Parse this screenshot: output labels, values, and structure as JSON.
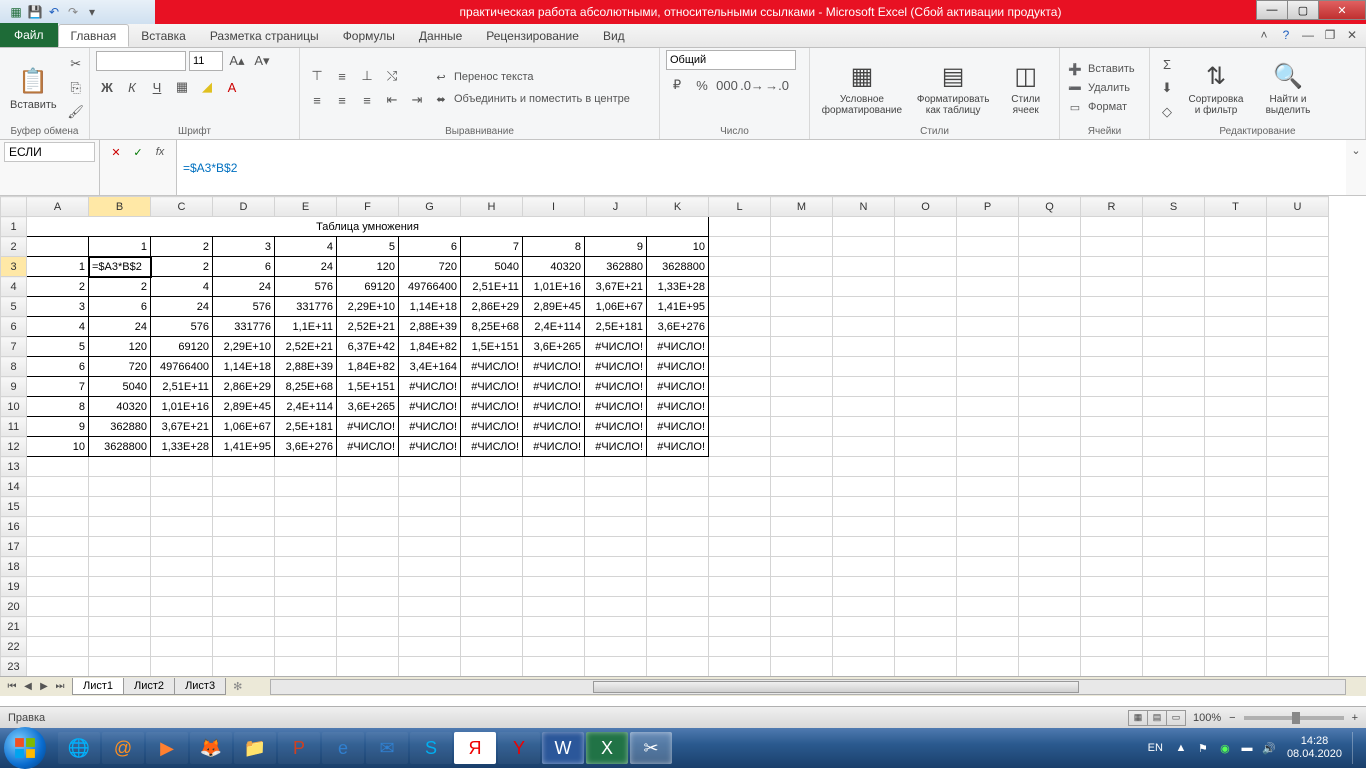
{
  "titlebar": {
    "title": "практическая работа абсолютными, относительными ссылками  -  Microsoft Excel (Сбой активации продукта)"
  },
  "ribbon": {
    "file": "Файл",
    "tabs": [
      "Главная",
      "Вставка",
      "Разметка страницы",
      "Формулы",
      "Данные",
      "Рецензирование",
      "Вид"
    ],
    "activeTab": 0,
    "groups": {
      "clipboard": {
        "label": "Буфер обмена",
        "paste": "Вставить"
      },
      "font": {
        "label": "Шрифт",
        "fontName": "",
        "fontSize": "11"
      },
      "align": {
        "label": "Выравнивание",
        "wrap": "Перенос текста",
        "merge": "Объединить и поместить в центре"
      },
      "number": {
        "label": "Число",
        "format": "Общий"
      },
      "styles": {
        "label": "Стили",
        "cond": "Условное форматирование",
        "table": "Форматировать как таблицу",
        "cell": "Стили ячеек"
      },
      "cells": {
        "label": "Ячейки",
        "insert": "Вставить",
        "delete": "Удалить",
        "format": "Формат"
      },
      "editing": {
        "label": "Редактирование",
        "sort": "Сортировка и фильтр",
        "find": "Найти и выделить"
      }
    }
  },
  "formula_bar": {
    "name_box": "ЕСЛИ",
    "formula": "=$A3*B$2"
  },
  "grid": {
    "columns": [
      "A",
      "B",
      "C",
      "D",
      "E",
      "F",
      "G",
      "H",
      "I",
      "J",
      "K",
      "L",
      "M",
      "N",
      "O",
      "P",
      "Q",
      "R",
      "S",
      "T",
      "U"
    ],
    "active_cell": "B3",
    "title_text": "Таблица умножения",
    "title_span": [
      0,
      10
    ],
    "data_rows": 12,
    "blank_rows_to": 23,
    "rows": [
      null,
      [
        "",
        "1",
        "2",
        "3",
        "4",
        "5",
        "6",
        "7",
        "8",
        "9",
        "10"
      ],
      [
        "1",
        "=$A3*B$2",
        "2",
        "6",
        "24",
        "120",
        "720",
        "5040",
        "40320",
        "362880",
        "3628800"
      ],
      [
        "2",
        "2",
        "4",
        "24",
        "576",
        "69120",
        "49766400",
        "2,51E+11",
        "1,01E+16",
        "3,67E+21",
        "1,33E+28"
      ],
      [
        "3",
        "6",
        "24",
        "576",
        "331776",
        "2,29E+10",
        "1,14E+18",
        "2,86E+29",
        "2,89E+45",
        "1,06E+67",
        "1,41E+95"
      ],
      [
        "4",
        "24",
        "576",
        "331776",
        "1,1E+11",
        "2,52E+21",
        "2,88E+39",
        "8,25E+68",
        "2,4E+114",
        "2,5E+181",
        "3,6E+276"
      ],
      [
        "5",
        "120",
        "69120",
        "2,29E+10",
        "2,52E+21",
        "6,37E+42",
        "1,84E+82",
        "1,5E+151",
        "3,6E+265",
        "#ЧИСЛО!",
        "#ЧИСЛО!"
      ],
      [
        "6",
        "720",
        "49766400",
        "1,14E+18",
        "2,88E+39",
        "1,84E+82",
        "3,4E+164",
        "#ЧИСЛО!",
        "#ЧИСЛО!",
        "#ЧИСЛО!",
        "#ЧИСЛО!"
      ],
      [
        "7",
        "5040",
        "2,51E+11",
        "2,86E+29",
        "8,25E+68",
        "1,5E+151",
        "#ЧИСЛО!",
        "#ЧИСЛО!",
        "#ЧИСЛО!",
        "#ЧИСЛО!",
        "#ЧИСЛО!"
      ],
      [
        "8",
        "40320",
        "1,01E+16",
        "2,89E+45",
        "2,4E+114",
        "3,6E+265",
        "#ЧИСЛО!",
        "#ЧИСЛО!",
        "#ЧИСЛО!",
        "#ЧИСЛО!",
        "#ЧИСЛО!"
      ],
      [
        "9",
        "362880",
        "3,67E+21",
        "1,06E+67",
        "2,5E+181",
        "#ЧИСЛО!",
        "#ЧИСЛО!",
        "#ЧИСЛО!",
        "#ЧИСЛО!",
        "#ЧИСЛО!",
        "#ЧИСЛО!"
      ],
      [
        "10",
        "3628800",
        "1,33E+28",
        "1,41E+95",
        "3,6E+276",
        "#ЧИСЛО!",
        "#ЧИСЛО!",
        "#ЧИСЛО!",
        "#ЧИСЛО!",
        "#ЧИСЛО!",
        "#ЧИСЛО!"
      ]
    ]
  },
  "sheets": {
    "tabs": [
      "Лист1",
      "Лист2",
      "Лист3"
    ],
    "active": 0
  },
  "status": {
    "mode": "Правка",
    "zoom": "100%"
  },
  "taskbar": {
    "lang": "EN",
    "time": "14:28",
    "date": "08.04.2020"
  }
}
